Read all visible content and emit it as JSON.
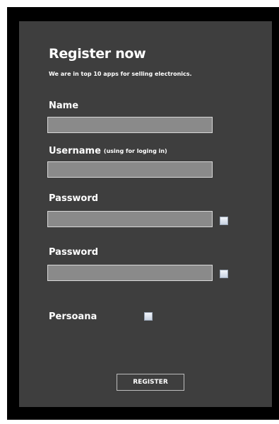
{
  "form": {
    "title": "Register now",
    "subtitle": "We are in top 10 apps for selling electronics.",
    "name_label": "Name",
    "name_value": "",
    "username_label": "Username",
    "username_hint": "(using for loging in)",
    "username_value": "",
    "password_label": "Password",
    "password_value": "",
    "password_confirm_label": "Password",
    "password_confirm_value": "",
    "persoana_label": "Persoana",
    "register_label": "REGISTER"
  }
}
